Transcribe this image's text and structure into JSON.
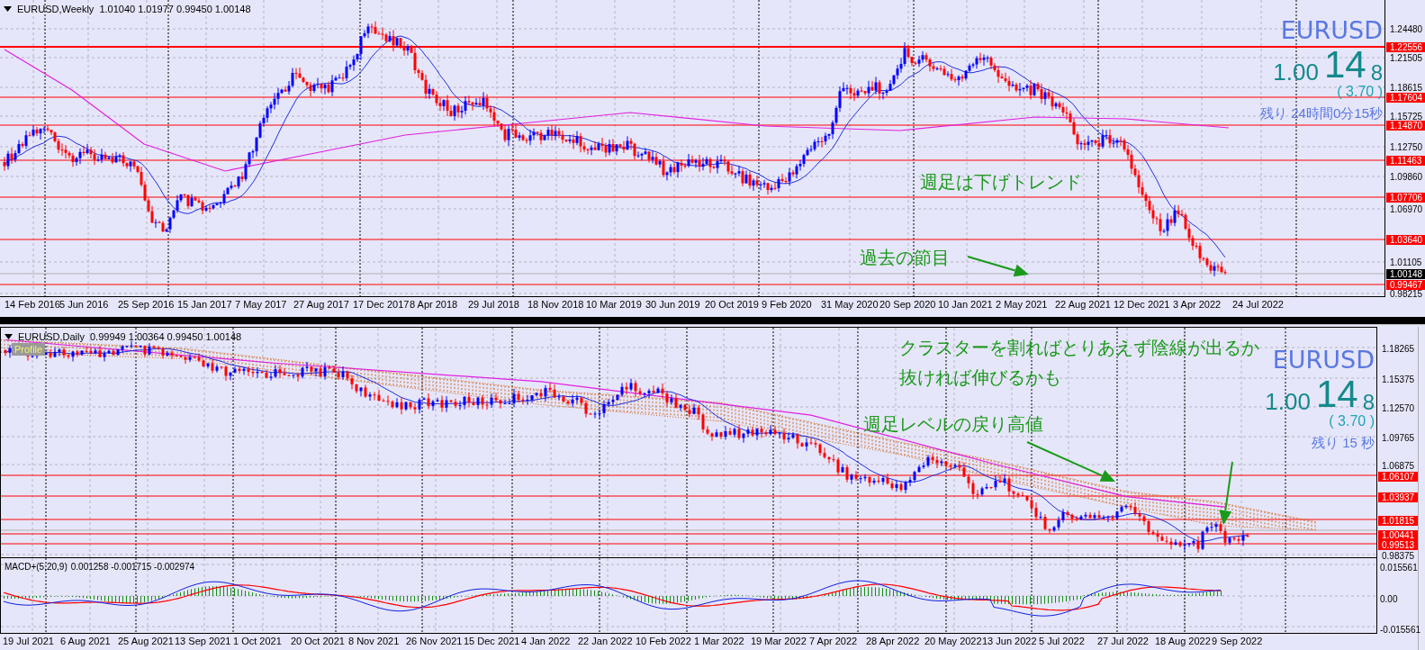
{
  "charts": [
    {
      "kind": "weekly",
      "title": "EURUSD,Weekly",
      "ohlc": "1.01040 1.01977 0.99450 1.00148",
      "price_ticks": [
        "1.24480",
        "1.21505",
        "1.18615",
        "1.15725",
        "1.12750",
        "1.09860",
        "1.06970",
        "1.01105",
        "0.98215"
      ],
      "level_tags": [
        "1.22556",
        "1.17604",
        "1.14870",
        "1.11463",
        "1.07706",
        "1.03640",
        "0.99467"
      ],
      "current_tag": "1.00148",
      "ticker": {
        "symbol": "EURUSD",
        "price_head": "1.00",
        "price_pips": "14",
        "price_tail": "8",
        "spread": "( 3.70 )",
        "remaining": "残り 24時間0分15秒"
      },
      "notes": [
        "週足は下げトレンド",
        "過去の節目"
      ],
      "dates": [
        "14 Feb 2016",
        "5 Jun 2016",
        "25 Sep 2016",
        "15 Jan 2017",
        "7 May 2017",
        "27 Aug 2017",
        "17 Dec 2017",
        "8 Apr 2018",
        "29 Jul 2018",
        "18 Nov 2018",
        "10 Mar 2019",
        "30 Jun 2019",
        "20 Oct 2019",
        "9 Feb 2020",
        "31 May 2020",
        "20 Sep 2020",
        "10 Jan 2021",
        "2 May 2021",
        "22 Aug 2021",
        "12 Dec 2021",
        "3 Apr 2022",
        "24 Jul 2022"
      ]
    },
    {
      "kind": "daily",
      "title": "EURUSD,Daily",
      "ohlc": "0.99949 1.00364 0.99450 1.00148",
      "profile_button": "Profile",
      "price_ticks": [
        "1.18265",
        "1.15375",
        "1.12570",
        "1.09765",
        "1.06875",
        "0.98375"
      ],
      "level_tags": [
        "1.06107",
        "1.03937",
        "1.01815",
        "1.00441",
        "0.99513"
      ],
      "ticker": {
        "symbol": "EURUSD",
        "price_head": "1.00",
        "price_pips": "14",
        "price_tail": "8",
        "spread": "( 3.70 )",
        "remaining": "残り 15 秒"
      },
      "notes": [
        "クラスターを割ればとりあえず陰線が出るか",
        "抜ければ伸びるかも",
        "週足レベルの戻り高値"
      ],
      "indicator": {
        "title": "MACD+(5,20,9)",
        "values": "0.001258 -0.001715 -0.002974",
        "ticks": [
          "0.015561",
          "0.00",
          "-0.015561"
        ]
      },
      "dates": [
        "19 Jul 2021",
        "6 Aug 2021",
        "25 Aug 2021",
        "13 Sep 2021",
        "1 Oct 2021",
        "20 Oct 2021",
        "8 Nov 2021",
        "26 Nov 2021",
        "15 Dec 2021",
        "4 Jan 2022",
        "22 Jan 2022",
        "10 Feb 2022",
        "1 Mar 2022",
        "19 Mar 2022",
        "7 Apr 2022",
        "28 Apr 2022",
        "20 May 2022",
        "13 Jun 2022",
        "5 Jul 2022",
        "27 Jul 2022",
        "18 Aug 2022",
        "9 Sep 2022"
      ]
    }
  ]
}
